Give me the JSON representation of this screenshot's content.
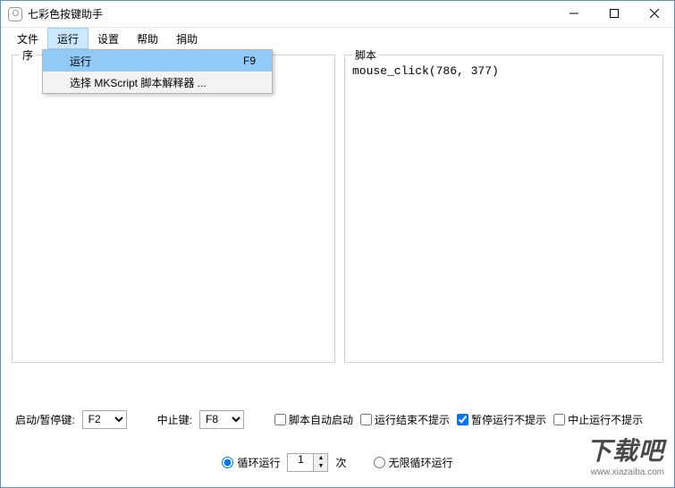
{
  "window": {
    "title": "七彩色按键助手"
  },
  "menu": {
    "items": [
      "文件",
      "运行",
      "设置",
      "帮助",
      "捐助"
    ],
    "dropdown": {
      "run": {
        "label": "运行",
        "shortcut": "F9"
      },
      "select": {
        "label": "选择 MKScript 脚本解释器 ..."
      }
    }
  },
  "panels": {
    "left": {
      "header": "序"
    },
    "right": {
      "header": "脚本",
      "content": "mouse_click(786, 377)"
    }
  },
  "controls": {
    "start_pause_label": "启动/暂停键:",
    "start_pause_value": "F2",
    "stop_label": "中止键:",
    "stop_value": "F8",
    "chk_autostart": "脚本自动启动",
    "chk_end_noprompt": "运行结束不提示",
    "chk_pause_noprompt": "暂停运行不提示",
    "chk_stop_noprompt": "中止运行不提示",
    "radio_loop": "循环运行",
    "loop_count": "1",
    "loop_unit": "次",
    "radio_infinite": "无限循环运行"
  },
  "watermark": {
    "main": "下载吧",
    "sub": "www.xiazaiba.com"
  }
}
